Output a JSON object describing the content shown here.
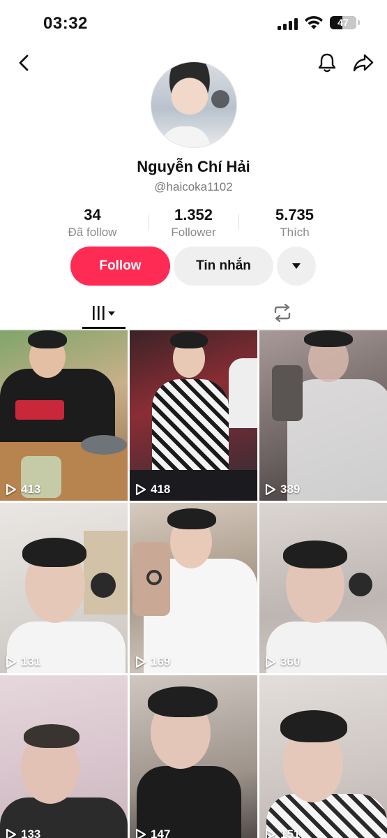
{
  "status_bar": {
    "time": "03:32",
    "battery": "47"
  },
  "profile": {
    "name": "Nguyễn Chí Hải",
    "handle": "@haicoka1102",
    "stats": [
      {
        "value": "34",
        "label": "Đã follow"
      },
      {
        "value": "1.352",
        "label": "Follower"
      },
      {
        "value": "5.735",
        "label": "Thích"
      }
    ]
  },
  "actions": {
    "follow": "Follow",
    "message": "Tin nhắn"
  },
  "videos": [
    {
      "views": "413"
    },
    {
      "views": "418"
    },
    {
      "views": "389"
    },
    {
      "views": "131"
    },
    {
      "views": "169"
    },
    {
      "views": "360"
    },
    {
      "views": "133"
    },
    {
      "views": "147"
    },
    {
      "views": "151"
    }
  ]
}
